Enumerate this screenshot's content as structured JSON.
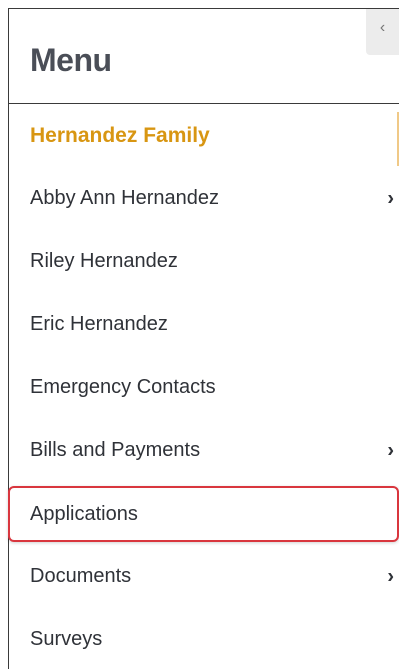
{
  "menu": {
    "title": "Menu",
    "collapse_icon": "chevron-left-icon",
    "items": [
      {
        "label": "Hernandez Family",
        "active": true,
        "has_submenu": false
      },
      {
        "label": "Abby Ann Hernandez",
        "active": false,
        "has_submenu": true
      },
      {
        "label": "Riley Hernandez",
        "active": false,
        "has_submenu": false
      },
      {
        "label": "Eric Hernandez",
        "active": false,
        "has_submenu": false
      },
      {
        "label": "Emergency Contacts",
        "active": false,
        "has_submenu": false
      },
      {
        "label": "Bills and Payments",
        "active": false,
        "has_submenu": true
      },
      {
        "label": "Applications",
        "active": false,
        "has_submenu": false,
        "highlighted": true
      },
      {
        "label": "Documents",
        "active": false,
        "has_submenu": true
      },
      {
        "label": "Surveys",
        "active": false,
        "has_submenu": false
      }
    ]
  },
  "colors": {
    "active_text": "#d89612",
    "highlight_border": "#d9363e",
    "text": "#2f3238",
    "title": "#4a4e57"
  },
  "glyphs": {
    "collapse": "‹",
    "chevron_right": "›"
  }
}
